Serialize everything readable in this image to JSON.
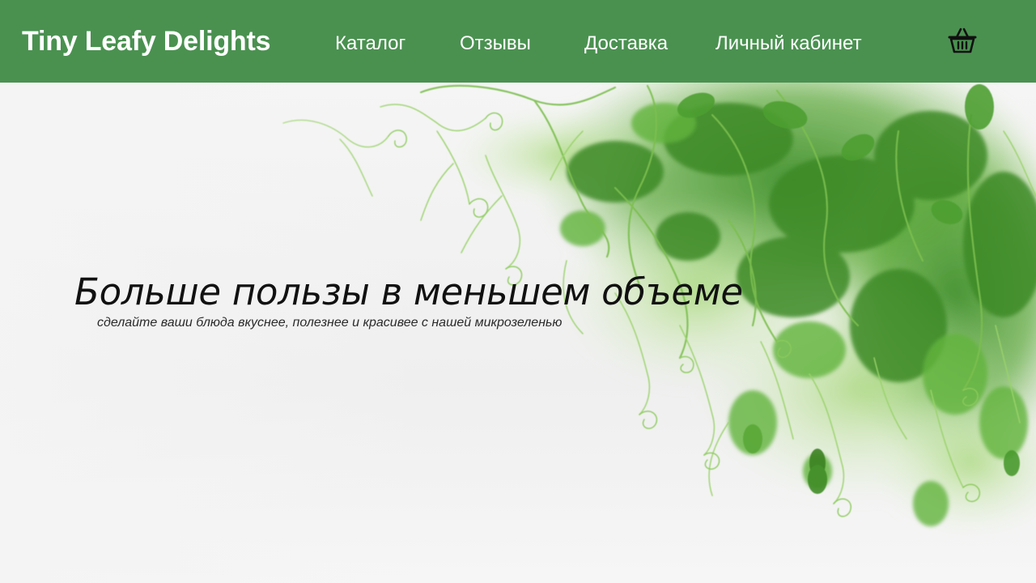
{
  "header": {
    "logo": "Tiny Leafy Delights",
    "nav": {
      "catalog": "Каталог",
      "reviews": "Отзывы",
      "delivery": "Доставка",
      "account": "Личный кабинет"
    },
    "cart_icon": "basket-icon"
  },
  "hero": {
    "title": "Больше пользы в меньшем объеме",
    "subtitle": "сделайте ваши блюда вкуснее, полезнее и красивее с нашей микрозеленью",
    "image": "pea-microgreens-photo"
  },
  "colors": {
    "header_bg": "#4a9150",
    "header_text": "#ffffff",
    "hero_bg": "#f3f3f3",
    "leaf_green": "#5aa032"
  }
}
